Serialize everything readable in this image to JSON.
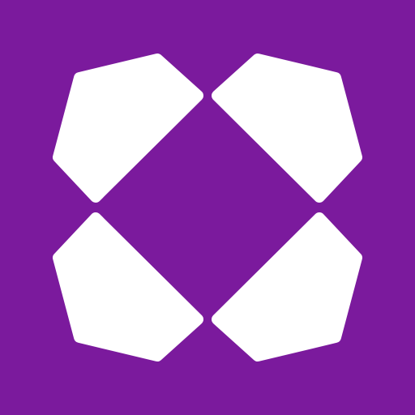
{
  "logo": {
    "icon": "four-petal-cross-logo-icon",
    "background_color": "#7B1A9D",
    "shape_color": "#FFFFFF"
  }
}
